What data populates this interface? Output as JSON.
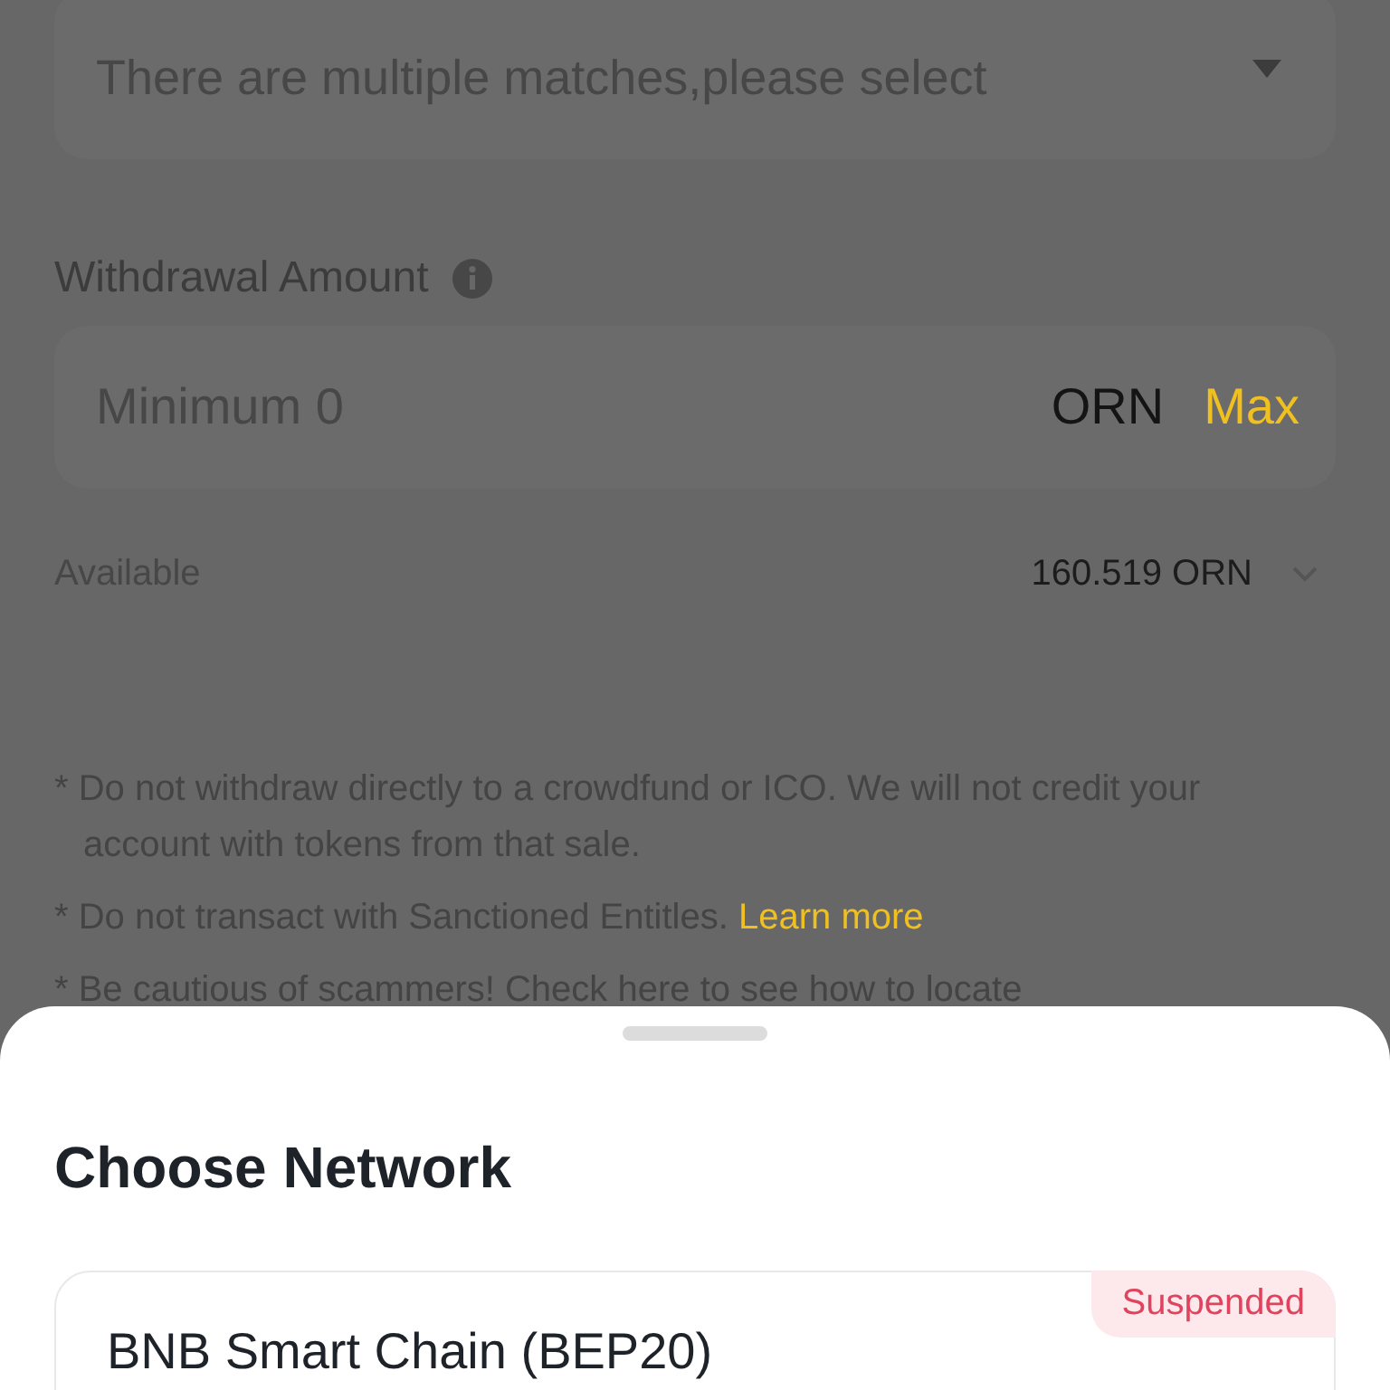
{
  "address_select": {
    "placeholder": "There are multiple matches,please select"
  },
  "amount": {
    "label": "Withdrawal Amount",
    "placeholder": "Minimum 0",
    "unit": "ORN",
    "max_button": "Max"
  },
  "available": {
    "label": "Available",
    "value": "160.519 ORN"
  },
  "notes": [
    {
      "text": "* Do not withdraw directly to a crowdfund or ICO. We will not credit your account with tokens from that sale."
    },
    {
      "text": "* Do not transact with Sanctioned Entitles.",
      "link": "Learn more"
    },
    {
      "text": "* Be cautious of scammers! Check here to see how to locate"
    }
  ],
  "sheet": {
    "title": "Choose Network",
    "networks": [
      {
        "name": "BNB Smart Chain (BEP20)",
        "suspended": true,
        "badge": "Suspended"
      }
    ]
  }
}
